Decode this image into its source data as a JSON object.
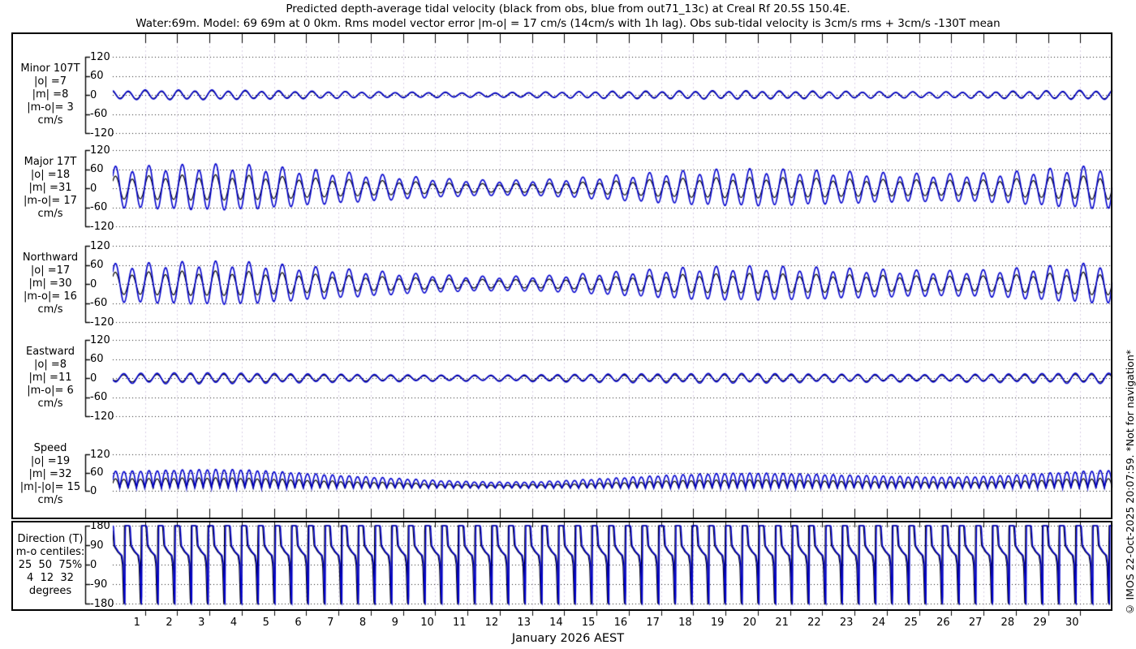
{
  "header": {
    "title_line1": "Predicted depth-average tidal velocity (black from obs, blue from out71_13c) at Creal Rf 20.5S 150.4E.",
    "title_line2": "Water:69m. Model: 69 69m at 0 0km. Rms model vector error |m-o| = 17 cm/s (14cm/s with 1h lag). Obs sub-tidal velocity is 3cm/s rms + 3cm/s -130T mean"
  },
  "watermark": "© IMOS 22-Oct-2025 20:07:59. *Not for navigation*",
  "x_axis": {
    "label": "January 2026 AEST",
    "day_labels": [
      1,
      2,
      3,
      4,
      5,
      6,
      7,
      8,
      9,
      10,
      11,
      12,
      13,
      14,
      15,
      16,
      17,
      18,
      19,
      20,
      21,
      22,
      23,
      24,
      25,
      26,
      27,
      28,
      29,
      30
    ],
    "num_days": 31
  },
  "colors": {
    "obs": "#000000",
    "model": "#0000cd",
    "grid_vertical": "#d8cfe6",
    "grid_horizontal": "#1a1a1a",
    "frame": "#000000"
  },
  "chart_data": [
    {
      "id": "minor",
      "type": "line",
      "label_lines": [
        "Minor 107T",
        "|o| =7",
        "|m| =8",
        "|m-o|= 3",
        "cm/s"
      ],
      "units": "cm/s",
      "yticks": [
        120,
        60,
        0,
        -60,
        -120
      ],
      "ylim": [
        -120,
        120
      ],
      "period_hours": 12.42,
      "phase": 2.0,
      "series": [
        {
          "name": "model",
          "color_key": "model",
          "daily_amplitude": [
            13,
            14,
            14,
            14,
            13,
            12,
            11,
            10,
            9,
            8,
            8,
            7,
            7,
            8,
            9,
            10,
            11,
            11,
            12,
            12,
            12,
            11,
            11,
            10,
            9,
            9,
            9,
            10,
            11,
            12,
            13,
            13
          ]
        },
        {
          "name": "obs",
          "color_key": "obs",
          "daily_amplitude": [
            11,
            12,
            12,
            12,
            11,
            10,
            9,
            9,
            8,
            7,
            7,
            6,
            6,
            7,
            8,
            9,
            9,
            9,
            10,
            10,
            10,
            9,
            9,
            9,
            8,
            8,
            8,
            9,
            9,
            10,
            11,
            11
          ]
        }
      ]
    },
    {
      "id": "major",
      "type": "line",
      "label_lines": [
        "Major 17T",
        "|o| =18",
        "|m| =31",
        "|m-o|= 17",
        "cm/s"
      ],
      "units": "cm/s",
      "yticks": [
        120,
        60,
        0,
        -60,
        -120
      ],
      "ylim": [
        -120,
        120
      ],
      "period_hours": 12.42,
      "phase": 0.5,
      "series": [
        {
          "name": "model",
          "color_key": "model",
          "daily_amplitude": [
            60,
            62,
            65,
            67,
            66,
            60,
            53,
            46,
            40,
            34,
            28,
            24,
            22,
            23,
            27,
            33,
            39,
            45,
            50,
            53,
            54,
            52,
            49,
            46,
            43,
            41,
            40,
            42,
            47,
            54,
            60,
            65
          ]
        },
        {
          "name": "obs",
          "color_key": "obs",
          "daily_amplitude": [
            33,
            34,
            36,
            37,
            36,
            33,
            29,
            25,
            22,
            19,
            15,
            13,
            12,
            13,
            15,
            18,
            21,
            25,
            28,
            29,
            30,
            29,
            27,
            25,
            24,
            23,
            22,
            23,
            26,
            30,
            33,
            36
          ]
        }
      ]
    },
    {
      "id": "northward",
      "type": "line",
      "label_lines": [
        "Northward",
        "|o| =17",
        "|m| =30",
        "|m-o|= 16",
        "cm/s"
      ],
      "units": "cm/s",
      "yticks": [
        120,
        60,
        0,
        -60,
        -120
      ],
      "ylim": [
        -120,
        120
      ],
      "period_hours": 12.42,
      "phase": 0.55,
      "series": [
        {
          "name": "model",
          "color_key": "model",
          "daily_amplitude": [
            56,
            58,
            61,
            63,
            62,
            56,
            49,
            43,
            37,
            31,
            26,
            22,
            21,
            22,
            25,
            31,
            36,
            42,
            47,
            49,
            50,
            48,
            46,
            43,
            40,
            38,
            37,
            39,
            44,
            50,
            56,
            61
          ]
        },
        {
          "name": "obs",
          "color_key": "obs",
          "daily_amplitude": [
            32,
            33,
            35,
            36,
            35,
            32,
            28,
            24,
            21,
            18,
            15,
            13,
            12,
            12,
            14,
            18,
            21,
            24,
            27,
            28,
            29,
            27,
            26,
            25,
            23,
            22,
            21,
            22,
            25,
            29,
            32,
            35
          ]
        }
      ]
    },
    {
      "id": "eastward",
      "type": "line",
      "label_lines": [
        "Eastward",
        "|o| =8",
        "|m| =11",
        "|m-o|= 6",
        "cm/s"
      ],
      "units": "cm/s",
      "yticks": [
        120,
        60,
        0,
        -60,
        -120
      ],
      "ylim": [
        -120,
        120
      ],
      "period_hours": 12.42,
      "phase": 3.65,
      "series": [
        {
          "name": "model",
          "color_key": "model",
          "daily_amplitude": [
            14,
            15,
            16,
            16,
            15,
            14,
            13,
            12,
            11,
            10,
            9,
            9,
            9,
            10,
            11,
            12,
            13,
            13,
            14,
            14,
            14,
            13,
            12,
            12,
            11,
            11,
            11,
            12,
            13,
            14,
            15,
            15
          ]
        },
        {
          "name": "obs",
          "color_key": "obs",
          "daily_amplitude": [
            10,
            11,
            12,
            12,
            11,
            10,
            9,
            9,
            8,
            7,
            7,
            7,
            7,
            7,
            8,
            9,
            9,
            9,
            10,
            10,
            10,
            9,
            9,
            9,
            8,
            8,
            8,
            9,
            9,
            10,
            11,
            11
          ]
        }
      ]
    },
    {
      "id": "speed",
      "type": "line",
      "label_lines": [
        "Speed",
        "|o| =19",
        "|m| =32",
        "|m|-|o|= 15",
        "cm/s"
      ],
      "units": "cm/s",
      "yticks": [
        120,
        60,
        0
      ],
      "ylim": [
        0,
        120
      ],
      "period_hours": 12.42,
      "phase": 0.5,
      "base_value": 7,
      "series": [
        {
          "name": "model",
          "color_key": "model",
          "daily_amplitude": [
            60,
            62,
            65,
            67,
            66,
            60,
            53,
            46,
            40,
            34,
            28,
            24,
            22,
            23,
            27,
            33,
            39,
            45,
            50,
            53,
            54,
            52,
            49,
            46,
            43,
            41,
            40,
            42,
            47,
            54,
            60,
            65
          ]
        },
        {
          "name": "obs",
          "color_key": "obs",
          "daily_amplitude": [
            33,
            34,
            36,
            37,
            36,
            33,
            29,
            25,
            22,
            19,
            15,
            13,
            12,
            13,
            15,
            18,
            21,
            25,
            28,
            29,
            30,
            29,
            27,
            25,
            24,
            23,
            22,
            23,
            26,
            30,
            33,
            36
          ]
        }
      ]
    },
    {
      "id": "direction",
      "type": "line",
      "label_lines": [
        "Direction (T)",
        "m-o centiles:",
        "25  50  75%",
        "4  12  32",
        "degrees"
      ],
      "units": "degrees",
      "yticks": [
        180,
        90,
        0,
        -90,
        -180
      ],
      "ylim": [
        -180,
        180
      ],
      "period_hours": 12.42,
      "phase": 0.0,
      "waveform_keypoints": [
        [
          0,
          180
        ],
        [
          0.04,
          176
        ],
        [
          0.11,
          88
        ],
        [
          0.33,
          60
        ],
        [
          0.55,
          42
        ],
        [
          0.63,
          0
        ],
        [
          0.7,
          -176
        ],
        [
          0.73,
          -180
        ],
        [
          0.745,
          180
        ],
        [
          1,
          180
        ]
      ],
      "series": [
        {
          "name": "model",
          "color_key": "model",
          "phase_offset": 0.0
        },
        {
          "name": "obs",
          "color_key": "obs",
          "phase_offset": 0.028
        }
      ]
    }
  ]
}
